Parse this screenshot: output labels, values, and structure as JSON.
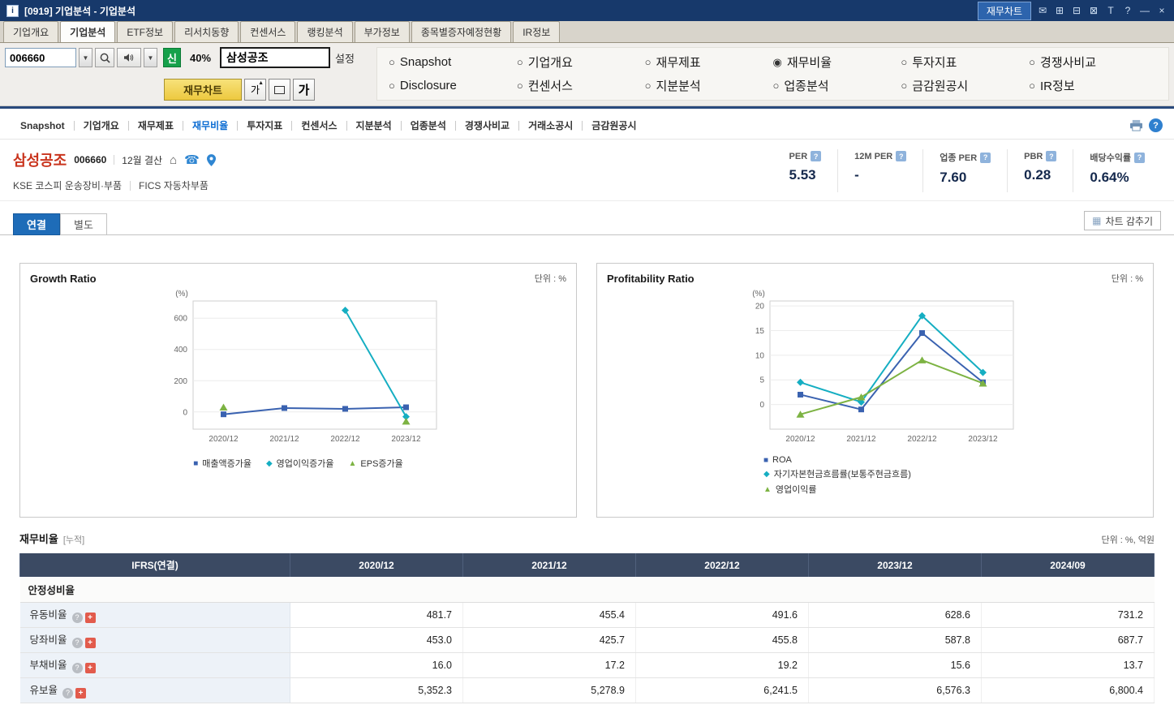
{
  "window": {
    "title": "[0919] 기업분석 - 기업분석",
    "chart_button_label": "재무차트"
  },
  "icons": {
    "mail": "✉",
    "tile": "⊞",
    "cascade": "⊟",
    "screen": "⊠",
    "text_tool": "T",
    "minimize": "—",
    "close": "×",
    "dropdown": "▼",
    "home": "⌂",
    "phone": "☎",
    "chart_grid": "▦",
    "radio_on": "◉",
    "radio_off": "○",
    "question": "?",
    "plus": "+",
    "font_up": "▲"
  },
  "main_tabs": {
    "items": [
      "기업개요",
      "기업분석",
      "ETF정보",
      "리서치동향",
      "컨센서스",
      "랭킹분석",
      "부가정보",
      "종목별증자예정현황",
      "IR정보"
    ],
    "active": "기업분석"
  },
  "toolbar": {
    "stock_code": "006660",
    "credit_badge": "신",
    "percent": "40%",
    "stock_name": "삼성공조",
    "settings_label": "설정",
    "finance_chart_button": "재무차트",
    "font_button_small": "가",
    "font_button_large": "가"
  },
  "radios": {
    "row1": [
      "Snapshot",
      "기업개요",
      "재무제표",
      "재무비율",
      "투자지표",
      "경쟁사비교"
    ],
    "row2": [
      "Disclosure",
      "컨센서스",
      "지분분석",
      "업종분석",
      "금감원공시",
      "IR정보"
    ],
    "selected": "재무비율"
  },
  "subnav": {
    "items": [
      "Snapshot",
      "기업개요",
      "재무제표",
      "재무비율",
      "투자지표",
      "컨센서스",
      "지분분석",
      "업종분석",
      "경쟁사비교",
      "거래소공시",
      "금감원공시"
    ],
    "active": "재무비율"
  },
  "company": {
    "name": "삼성공조",
    "code": "006660",
    "settlement": "12월 결산",
    "market_info": "KSE  코스피 운송장비·부품",
    "fics_info": "FICS 자동차부품",
    "metrics": [
      {
        "label": "PER",
        "value": "5.53"
      },
      {
        "label": "12M PER",
        "value": "-"
      },
      {
        "label": "업종 PER",
        "value": "7.60"
      },
      {
        "label": "PBR",
        "value": "0.28"
      },
      {
        "label": "배당수익률",
        "value": "0.64%"
      }
    ]
  },
  "view_tabs": {
    "items": [
      "연결",
      "별도"
    ],
    "active": "연결",
    "hide_chart_label": "차트 감추기"
  },
  "chart_data": [
    {
      "type": "line",
      "title": "Growth Ratio",
      "unit": "단위 : %",
      "ylabel": "(%)",
      "categories": [
        "2020/12",
        "2021/12",
        "2022/12",
        "2023/12"
      ],
      "ylim": [
        -110,
        710
      ],
      "yticks": [
        0,
        200,
        400,
        600
      ],
      "series": [
        {
          "name": "매출액증가율",
          "color": "#3a62b0",
          "marker": "square",
          "values": [
            -15,
            25,
            20,
            30
          ]
        },
        {
          "name": "영업이익증가율",
          "color": "#15aec2",
          "marker": "diamond",
          "values": [
            null,
            null,
            650,
            -30
          ]
        },
        {
          "name": "EPS증가율",
          "color": "#7db343",
          "marker": "triangle",
          "values": [
            30,
            null,
            null,
            -60
          ]
        }
      ],
      "legend_position": "bottom-horizontal"
    },
    {
      "type": "line",
      "title": "Profitability Ratio",
      "unit": "단위 : %",
      "ylabel": "(%)",
      "categories": [
        "2020/12",
        "2021/12",
        "2022/12",
        "2023/12"
      ],
      "ylim": [
        -5,
        21
      ],
      "yticks": [
        0,
        5,
        10,
        15,
        20
      ],
      "series": [
        {
          "name": "ROA",
          "color": "#3a62b0",
          "marker": "square",
          "values": [
            2,
            -1,
            14.5,
            4.5
          ]
        },
        {
          "name": "자기자본현금흐름률(보통주현금흐름)",
          "color": "#15aec2",
          "marker": "diamond",
          "values": [
            4.5,
            0.5,
            18,
            6.5
          ]
        },
        {
          "name": "영업이익률",
          "color": "#7db343",
          "marker": "triangle",
          "values": [
            -2,
            1.5,
            9,
            4.3
          ]
        }
      ],
      "legend_position": "bottom-vertical"
    }
  ],
  "financial_table": {
    "title": "재무비율",
    "subtitle": "[누적]",
    "unit": "단위 : %, 억원",
    "header": [
      "IFRS(연결)",
      "2020/12",
      "2021/12",
      "2022/12",
      "2023/12",
      "2024/09"
    ],
    "section_label": "안정성비율",
    "rows": [
      {
        "label": "유동비율",
        "values": [
          "481.7",
          "455.4",
          "491.6",
          "628.6",
          "731.2"
        ]
      },
      {
        "label": "당좌비율",
        "values": [
          "453.0",
          "425.7",
          "455.8",
          "587.8",
          "687.7"
        ]
      },
      {
        "label": "부채비율",
        "values": [
          "16.0",
          "17.2",
          "19.2",
          "15.6",
          "13.7"
        ]
      },
      {
        "label": "유보율",
        "values": [
          "5,352.3",
          "5,278.9",
          "6,241.5",
          "6,576.3",
          "6,800.4"
        ]
      }
    ]
  }
}
